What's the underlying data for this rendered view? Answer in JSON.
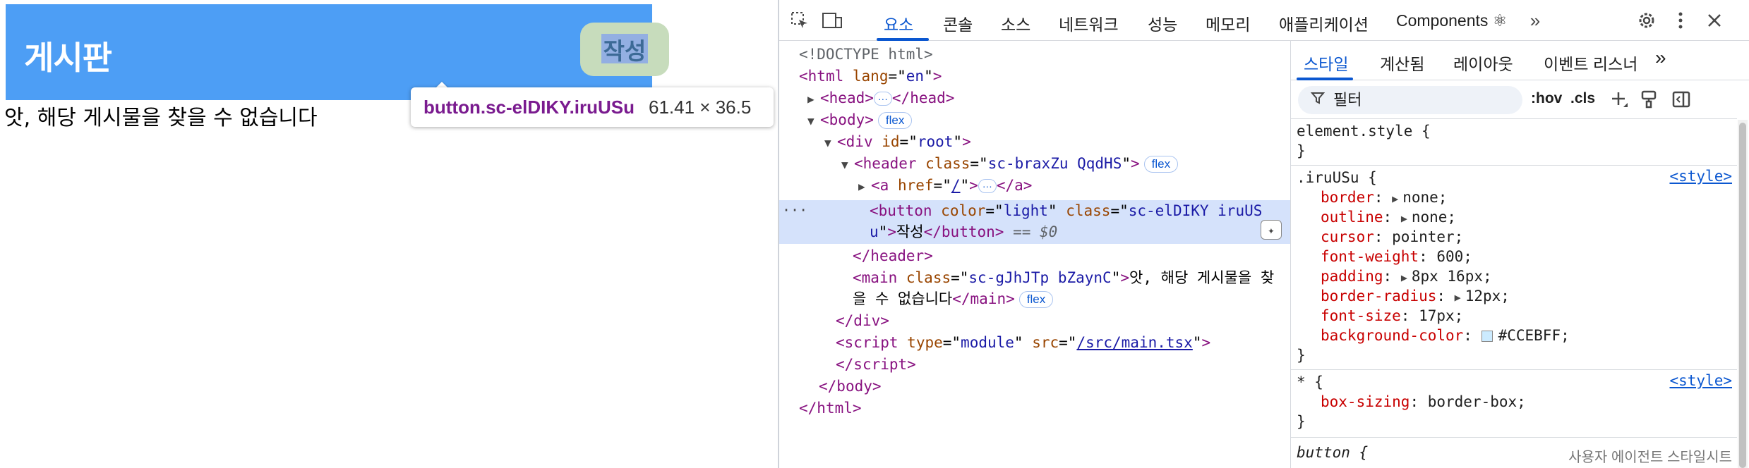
{
  "preview": {
    "site_title": "게시판",
    "write_button": "작성",
    "main_message": "앗, 해당 게시물을 찾을 수 없습니다",
    "tooltip": {
      "selector": "button.sc-elDIKY.iruUSu",
      "size": "61.41 × 36.5"
    }
  },
  "devtools": {
    "toolbar": {
      "inspect_icon": "select-element-icon",
      "device_icon": "device-toolbar-icon",
      "tabs": [
        "요소",
        "콘솔",
        "소스",
        "네트워크",
        "성능",
        "메모리",
        "애플리케이션",
        "Components ⚛"
      ],
      "more_tabs": "»",
      "settings_icon": "gear-icon",
      "menu_icon": "kebab-menu-icon",
      "close_icon": "close-icon"
    },
    "dom": {
      "doctype": "<!DOCTYPE html>",
      "html_open": "html",
      "html_lang_attr": "lang",
      "html_lang_val": "en",
      "head": "head",
      "body": "body",
      "div": "div",
      "div_id_attr": "id",
      "div_id_val": "root",
      "header": "header",
      "header_class_attr": "class",
      "header_class_val": "sc-braxZu QqdHS",
      "a": "a",
      "a_href_attr": "href",
      "a_href_val": "/",
      "button": "button",
      "button_color_attr": "color",
      "button_color_val": "light",
      "button_class_attr": "class",
      "button_class_val_1": "sc-elDIKY iruUS",
      "button_class_val_2": "u",
      "button_text": "작성",
      "selected_marker": "== $0",
      "main": "main",
      "main_class_attr": "class",
      "main_class_val": "sc-gJhJTp bZaynC",
      "main_text_1": "앗, 해당 게시물을 찾",
      "main_text_2": "을 수 없습니다",
      "script": "script",
      "script_type_attr": "type",
      "script_type_val": "module",
      "script_src_attr": "src",
      "script_src_val": "/src/main.tsx",
      "flex_badge": "flex",
      "ellipsis": "···"
    },
    "styles": {
      "sub_tabs": [
        "스타일",
        "계산됨",
        "레이아웃",
        "이벤트 리스너"
      ],
      "more_sub_tabs": "»",
      "filter_placeholder": "필터",
      "hov": ":hov",
      "cls": ".cls",
      "rules": {
        "element_style": "element.style {",
        "close": "}",
        "iru_selector": ".iruUSu {",
        "style_source": "<style>",
        "props": [
          {
            "name": "border",
            "value": "none;",
            "expandable": true
          },
          {
            "name": "outline",
            "value": "none;",
            "expandable": true
          },
          {
            "name": "cursor",
            "value": "pointer;",
            "expandable": false
          },
          {
            "name": "font-weight",
            "value": "600;",
            "expandable": false
          },
          {
            "name": "padding",
            "value": "8px 16px;",
            "expandable": true
          },
          {
            "name": "border-radius",
            "value": "12px;",
            "expandable": true
          },
          {
            "name": "font-size",
            "value": "17px;",
            "expandable": false
          },
          {
            "name": "background-color",
            "value": "#CCEBFF;",
            "expandable": false
          }
        ],
        "star_selector": "* {",
        "star_prop": {
          "name": "box-sizing",
          "value": "border-box;"
        },
        "button_selector": "button {",
        "ua_label": "사용자 에이전트 스타일시트"
      }
    }
  },
  "colors": {
    "header_blue": "#4d9ef5",
    "accent": "#0b57d0",
    "selection": "#d5e2fb",
    "swatch": "#CCEBFF"
  }
}
